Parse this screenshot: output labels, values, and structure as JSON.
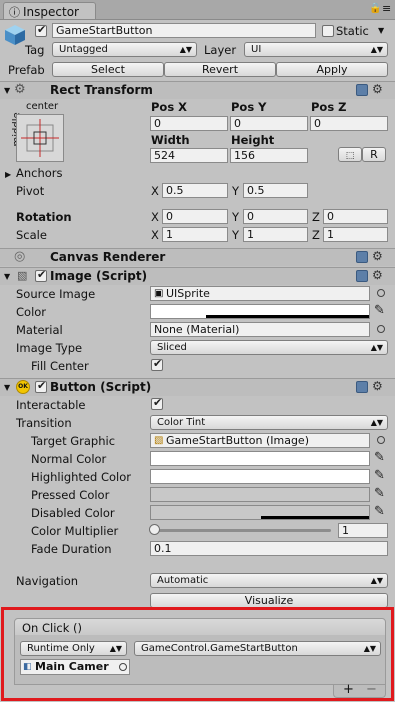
{
  "tab": {
    "label": "Inspector"
  },
  "object": {
    "name": "GameStartButton",
    "static_label": "Static",
    "tag_label": "Tag",
    "tag_value": "Untagged",
    "layer_label": "Layer",
    "layer_value": "UI",
    "prefab_label": "Prefab",
    "select": "Select",
    "revert": "Revert",
    "apply": "Apply"
  },
  "rect": {
    "title": "Rect Transform",
    "anchor_h": "center",
    "anchor_v": "middle",
    "posx_label": "Pos X",
    "posy_label": "Pos Y",
    "posz_label": "Pos Z",
    "posx": "0",
    "posy": "0",
    "posz": "0",
    "width_label": "Width",
    "height_label": "Height",
    "width": "524",
    "height": "156",
    "r_label": "R",
    "anchors_label": "Anchors",
    "pivot_label": "Pivot",
    "pivot_x": "0.5",
    "pivot_y": "0.5",
    "rotation_label": "Rotation",
    "rot_x": "0",
    "rot_y": "0",
    "rot_z": "0",
    "scale_label": "Scale",
    "scale_x": "1",
    "scale_y": "1",
    "scale_z": "1",
    "x": "X",
    "y": "Y",
    "z": "Z"
  },
  "canvas_renderer": {
    "title": "Canvas Renderer"
  },
  "image": {
    "title": "Image (Script)",
    "source_label": "Source Image",
    "source_value": "UISprite",
    "color_label": "Color",
    "material_label": "Material",
    "material_value": "None (Material)",
    "type_label": "Image Type",
    "type_value": "Sliced",
    "fill_label": "Fill Center"
  },
  "button": {
    "title": "Button (Script)",
    "interactable_label": "Interactable",
    "transition_label": "Transition",
    "transition_value": "Color Tint",
    "target_label": "Target Graphic",
    "target_value": "GameStartButton (Image)",
    "normal_label": "Normal Color",
    "highlighted_label": "Highlighted Color",
    "pressed_label": "Pressed Color",
    "disabled_label": "Disabled Color",
    "multiplier_label": "Color Multiplier",
    "multiplier_value": "1",
    "fade_label": "Fade Duration",
    "fade_value": "0.1",
    "navigation_label": "Navigation",
    "navigation_value": "Automatic",
    "visualize": "Visualize",
    "onclick_title": "On Click ()",
    "runtime_value": "Runtime Only",
    "function_value": "GameControl.GameStartButton",
    "object_value": "Main Camer",
    "add": "+",
    "remove": "−"
  },
  "colors": {
    "highlight_frame": "#e0191d",
    "panel": "#c2c2c2",
    "header": "#bdbdbd"
  }
}
